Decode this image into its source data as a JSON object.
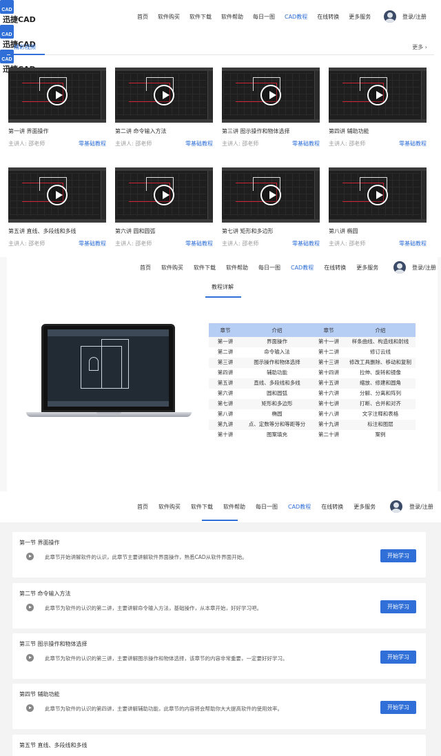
{
  "brand": {
    "logo_text": "CAD",
    "name": "迅捷CAD"
  },
  "nav": {
    "items": [
      "首页",
      "软件购买",
      "软件下载",
      "软件帮助",
      "每日一图",
      "CAD教程",
      "在线转换",
      "更多服务"
    ],
    "active": "CAD教程",
    "login": "登录/注册",
    "login_cut": "登录/注册",
    "login_cut2": "登录/注册"
  },
  "videos": {
    "tab": "精彩视频",
    "more": "更多 ›",
    "items": [
      {
        "title": "第一讲 界面操作",
        "teacher": "主讲人: 邵老师",
        "category": "零基础教程"
      },
      {
        "title": "第二讲 命令输入方法",
        "teacher": "主讲人: 邵老师",
        "category": "零基础教程"
      },
      {
        "title": "第三讲 图示操作和物体选择",
        "teacher": "主讲人: 邵老师",
        "category": "零基础教程"
      },
      {
        "title": "第四讲 辅助功能",
        "teacher": "主讲人: 邵老师",
        "category": "零基础教程"
      },
      {
        "title": "第五讲 直线、多段线和多线",
        "teacher": "主讲人: 邵老师",
        "category": "零基础教程"
      },
      {
        "title": "第六讲 圆和圆弧",
        "teacher": "主讲人: 邵老师",
        "category": "零基础教程"
      },
      {
        "title": "第七讲 矩形和多边形",
        "teacher": "主讲人: 邵老师",
        "category": "零基础教程"
      },
      {
        "title": "第八讲 椭圆",
        "teacher": "主讲人: 邵老师",
        "category": "零基础教程"
      }
    ]
  },
  "detail": {
    "title": "教程详解",
    "headers": [
      "章节",
      "介绍",
      "章节",
      "介绍"
    ],
    "rows": [
      [
        "第一讲",
        "界面操作",
        "第十一讲",
        "样条曲线、构造线和射线"
      ],
      [
        "第二讲",
        "命令输入法",
        "第十二讲",
        "修订云线"
      ],
      [
        "第三讲",
        "图示操作和物体选择",
        "第十三讲",
        "修改工具删除、移动和复制"
      ],
      [
        "第四讲",
        "辅助功能",
        "第十四讲",
        "拉伸、旋转和镜像"
      ],
      [
        "第五讲",
        "直线、多段线和多线",
        "第十五讲",
        "缩放、修建和圆角"
      ],
      [
        "第六讲",
        "圆和圆弧",
        "第十六讲",
        "分解、分离和阵列"
      ],
      [
        "第七讲",
        "矩形和多边形",
        "第十七讲",
        "打断、合并和对齐"
      ],
      [
        "第八讲",
        "椭圆",
        "第十八讲",
        "文字注释和表格"
      ],
      [
        "第九讲",
        "点、定数等分和等距等分",
        "第十九讲",
        "标注和图层"
      ],
      [
        "第十讲",
        "图案填充",
        "第二十讲",
        "案例"
      ]
    ]
  },
  "lessons": {
    "button": "开始学习",
    "items": [
      {
        "title": "第一节 界面操作",
        "desc": "此章节开始讲解软件的认识，此章节主要讲解软件界面操作，熟悉CAD从软件界面开始。"
      },
      {
        "title": "第二节 命令输入方法",
        "desc": "此章节为软件的认识的第二讲，主要讲解命令输入方法，基础操作，从本章开始，好好学习吧。"
      },
      {
        "title": "第三节 图示操作和物体选择",
        "desc": "此章节为软件的认识的第三讲，主要讲解图示操作和物体选择，该章节的内容非常重要，一定要好好学习。"
      },
      {
        "title": "第四节 辅助功能",
        "desc": "此章节为软件的认识的第四讲，主要讲解辅助功能，此章节的内容将会帮助你大大提高软件的使用效率。"
      },
      {
        "title": "第五节 直线、多段线和多线",
        "desc": ""
      }
    ]
  }
}
